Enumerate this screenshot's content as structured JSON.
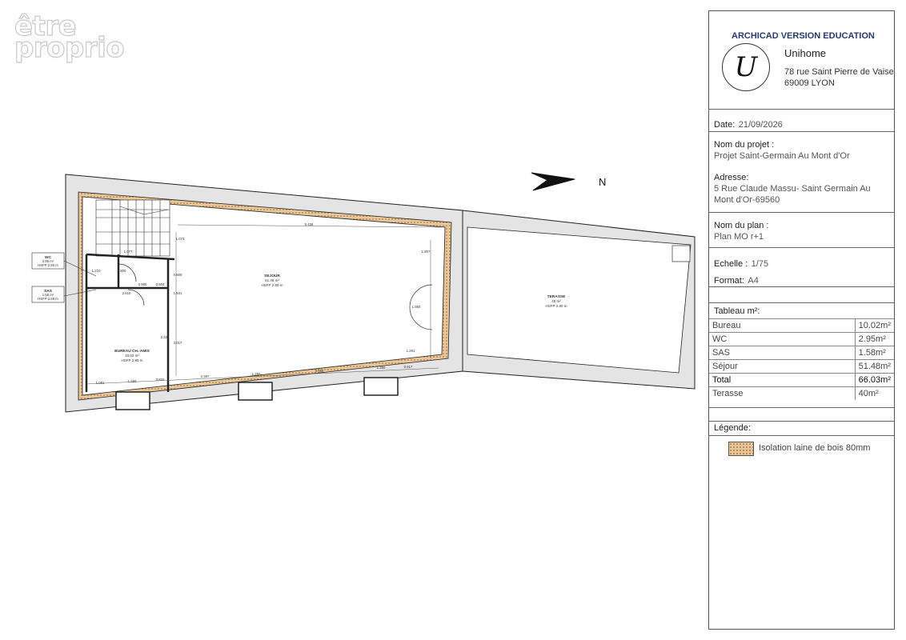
{
  "watermark": {
    "line1": "être",
    "line2": "proprio"
  },
  "title_block": {
    "edition": "ARCHICAD VERSION EDUCATION",
    "logo_letter": "U",
    "company": "Unihome",
    "address_line1": "78 rue Saint Pierre de Vaise",
    "address_line2": "69009 LYON",
    "date_label": "Date:",
    "date_value": "21/09/2026",
    "project_label": "Nom du projet :",
    "project_value": "Projet Saint-Germain Au Mont d'Or",
    "adresse_label": "Adresse:",
    "adresse_value1": "5 Rue Claude Massu- Saint Germain Au",
    "adresse_value2": "Mont d'Or-69560",
    "plan_label": "Nom du plan :",
    "plan_value": "Plan MO r+1",
    "echelle_label": "Echelle :",
    "echelle_value": "1/75",
    "format_label": "Format:",
    "format_value": "A4",
    "table_title": "Tableau m²:",
    "table_rows": [
      {
        "name": "Bureau",
        "value": "10.02m²"
      },
      {
        "name": "WC",
        "value": "2.95m²"
      },
      {
        "name": "SAS",
        "value": "1.58m²"
      },
      {
        "name": "Séjour",
        "value": "51.48m²"
      },
      {
        "name": "Total",
        "value": "66.03m²"
      },
      {
        "name": "Terasse",
        "value": "40m²"
      }
    ],
    "legend_title": "Légende:",
    "legend_item": "Isolation laine de bois 80mm"
  },
  "plan": {
    "north": "N",
    "rooms": {
      "sejour": {
        "name": "SEJOUR",
        "area": "51.48 m²",
        "hsfp": "HSFP 2.80 m"
      },
      "terasse": {
        "name": "TERASSE",
        "area": "40 m²",
        "hsfp": "HSFP 2.80 m"
      },
      "bureau": {
        "name": "BUREAU CH.-AMIS",
        "area": "10.02 m²",
        "hsfp": "HSFP 2.80 m"
      },
      "wc": {
        "name": "WC",
        "area": "2.95 m²",
        "hsfp": "HSFP 2.80 m"
      },
      "sas": {
        "name": "SAS",
        "area": "1.58 m²",
        "hsfp": "HSFP 2.80 m"
      }
    },
    "dimensions": {
      "top": "9.436",
      "bottom_left": "1.081",
      "bottom_1250a": "1.250",
      "bottom_0832": "0.832",
      "bottom_2387": "2.387",
      "bottom_1250b": "1.250",
      "bottom_3064": "3.064",
      "bottom_1250c": "1.250",
      "bottom_0617": "0.617",
      "right_1807": "1.807",
      "right_1950": "1.950",
      "right_1291": "1.291",
      "mid_3322": "3.322",
      "mid_3017": "3.017",
      "mid_1541": "1.541",
      "mid_0800": "0.800",
      "stair_1077": "1.077",
      "wc_0900": "0.900",
      "wc_0504": "0.504",
      "wc_1210": "1.210",
      "wc_0800": "0.800",
      "sas_2610": "2.610",
      "stair_1073": "1.073"
    }
  }
}
